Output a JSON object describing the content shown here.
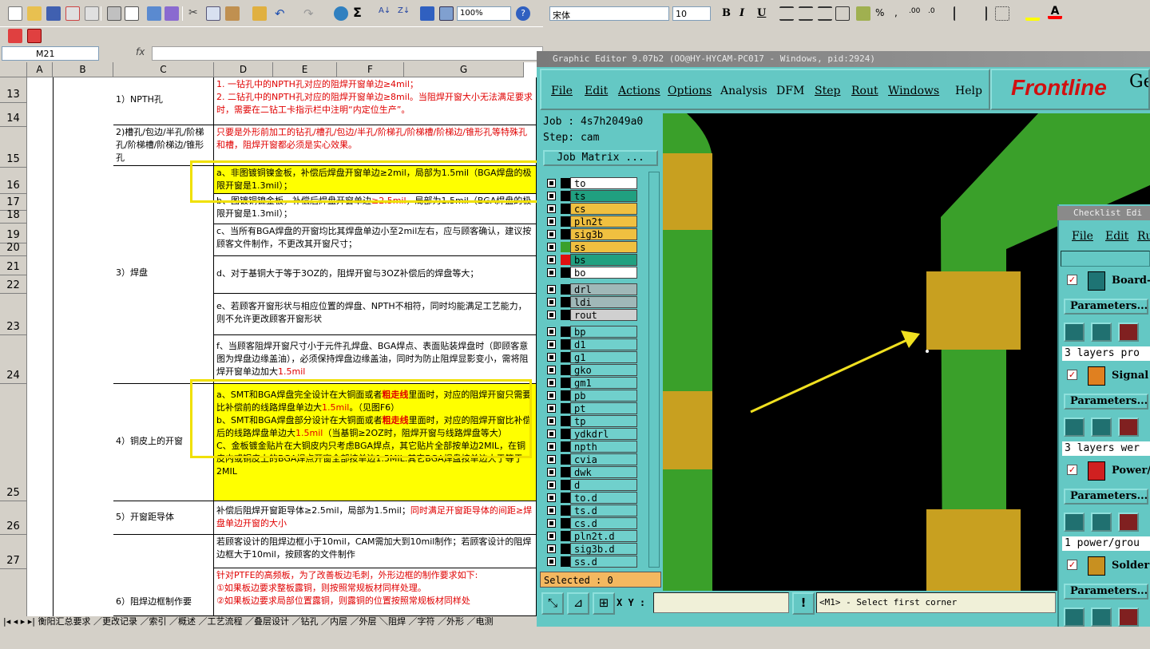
{
  "excel": {
    "zoom": "100%",
    "font": "宋体",
    "size": "10",
    "namebox": "M21",
    "fx": "fx",
    "col_headers": [
      "A",
      "B",
      "C",
      "D",
      "E",
      "F",
      "G"
    ],
    "row_headers": [
      "13",
      "14",
      "15",
      "16",
      "17",
      "18",
      "19",
      "20",
      "21",
      "22",
      "23",
      "24",
      "25",
      "26",
      "27"
    ],
    "rows": {
      "npth_label": "1）NPTH孔",
      "npth_text": "1. 一钻孔中的NPTH孔对应的阻焊开窗单边≥4mil；\n2. 二钻孔中的NPTH孔对应的阻焊开窗单边≥8mil。当阻焊开窗大小无法满足要求时，需要在二钻工卡指示栏中注明“内定位生产”。",
      "slot_label": "2)槽孔/包边/半孔/阶梯孔/阶梯槽/阶梯边/锥形孔",
      "slot_text": "只要是外形前加工的钻孔/槽孔/包边/半孔/阶梯孔/阶梯槽/阶梯边/锥形孔等特殊孔和槽，阻焊开窗都必须是实心效果。",
      "pad_label": "3）焊盘",
      "pad_a": "a、非图镀铜镍金板，补偿后焊盘开窗单边≥2mil，局部为1.5mil（BGA焊盘的极限开窗是1.3mil）；",
      "pad_b_1": "b、图镀铜镍金板，补偿后焊盘开窗单边",
      "pad_b_2": "≥2.5mil",
      "pad_b_3": "，局部为1.5mil（BGA焊盘的极限开窗是1.3mil）；",
      "pad_c": "c、当所有BGA焊盘的开窗均比其焊盘单边小至2mil左右，应与顾客确认，建议按顾客文件制作，不更改其开窗尺寸；",
      "pad_d": "d、对于基铜大于等于3OZ的，阻焊开窗与3OZ补偿后的焊盘等大；",
      "pad_e": "e、若顾客开窗形状与相应位置的焊盘、NPTH不相符，同时均能满足工艺能力，则不允许更改顾客开窗形状",
      "pad_f_1": "f、当顾客阻焊开窗尺寸小于元件孔焊盘、BGA焊点、表面贴装焊盘时（即顾客意图为焊盘边缘盖油），必须保持焊盘边缘盖油，同时为防止阻焊显影变小，需将阻焊开窗单边加大",
      "pad_f_2": "1.5mil",
      "copper_label": "4）铜皮上的开窗",
      "copper_a_1": "a、SMT和BGA焊盘完全设计在大铜面或者",
      "copper_a_2": "粗走线",
      "copper_a_3": "里面时，对应的阻焊开窗只需要比补偿前的线路焊盘单边大",
      "copper_a_4": "1.5mil",
      "copper_a_5": "。（见图F6）",
      "copper_b_1": "b、SMT和BGA焊盘部分设计在大铜面或者",
      "copper_b_2": "粗走线",
      "copper_b_3": "里面时，对应的阻焊开窗比补偿后的线路焊盘单边大",
      "copper_b_4": "1.5mil",
      "copper_b_5": "（当基铜≥2OZ时，阻焊开窗与线路焊盘等大）",
      "copper_c": "C、金板镀金贴片在大铜皮内只考虑BGA焊点，其它贴片全部按单边2MIL，在铜皮内或铜皮上的BGA焊点开窗全部按单边1.5MIL.其它BGA焊盘按单边大于等于2MIL",
      "window_label": "5）开窗距导体",
      "window_text_1": "补偿后阻焊开窗距导体≥2.5mil，局部为1.5mil；",
      "window_text_2": "同时满足开窗距导体的间距≥焊盘单边开窗的大小",
      "frame_label": "6）阻焊边框制作要",
      "frame_text_1": "若顾客设计的阻焊边框小于10mil，CAM需加大到10mil制作；若顾客设计的阻焊边框大于10mil，按顾客的文件制作",
      "frame_text_2": "针对PTFE的高频板，为了改善板边毛刺，外形边框的制作要求如下:\n①如果板边要求整板露铜，则按照常规板材同样处理。\n②如果板边要求局部位置露铜，则露铜的位置按照常规板材同样处"
    },
    "sheet_tabs": "衡阳汇总要求 ／更改记录 ／索引 ／概述 ／工艺流程 ／叠层设计 ／钻孔 ／内层 ／外层 ＼阻焊 ／字符 ／外形 ／电测"
  },
  "graphic_editor": {
    "title": "Graphic Editor 9.07b2 (OO@HY-HYCAM-PC017 - Windows, pid:2924)",
    "menu": [
      "File",
      "Edit",
      "Actions",
      "Options",
      "Analysis",
      "DFM",
      "Step",
      "Rout",
      "Windows",
      "Help"
    ],
    "logo": "Frontline",
    "logo_extra": "Ge",
    "job": "Job : 4s7h2049a0",
    "step": "Step: cam",
    "job_matrix": "Job Matrix ...",
    "layers": [
      {
        "name": "to",
        "color": "#ffffff"
      },
      {
        "name": "ts",
        "color": "#20a080"
      },
      {
        "name": "cs",
        "color": "#f0c040"
      },
      {
        "name": "pln2t",
        "color": "#f0c040"
      },
      {
        "name": "sig3b",
        "color": "#f0c040"
      },
      {
        "name": "ss",
        "color": "#f0c040"
      },
      {
        "name": "bs",
        "color": "#20a080"
      },
      {
        "name": "bo",
        "color": "#ffffff"
      },
      {
        "name": "drl",
        "color": "#a0b8b8"
      },
      {
        "name": "ldi",
        "color": "#a0b8b8"
      },
      {
        "name": "rout",
        "color": "#d0d0d0"
      },
      {
        "name": "bp",
        "color": "#70d0cc"
      },
      {
        "name": "d1",
        "color": "#70d0cc"
      },
      {
        "name": "g1",
        "color": "#70d0cc"
      },
      {
        "name": "gko",
        "color": "#70d0cc"
      },
      {
        "name": "gm1",
        "color": "#70d0cc"
      },
      {
        "name": "pb",
        "color": "#70d0cc"
      },
      {
        "name": "pt",
        "color": "#70d0cc"
      },
      {
        "name": "tp",
        "color": "#70d0cc"
      },
      {
        "name": "ydkdrl",
        "color": "#70d0cc"
      },
      {
        "name": "npth",
        "color": "#70d0cc"
      },
      {
        "name": "cvia",
        "color": "#70d0cc"
      },
      {
        "name": "dwk",
        "color": "#70d0cc"
      },
      {
        "name": "d",
        "color": "#70d0cc"
      },
      {
        "name": "to.d",
        "color": "#70d0cc"
      },
      {
        "name": "ts.d",
        "color": "#70d0cc"
      },
      {
        "name": "cs.d",
        "color": "#70d0cc"
      },
      {
        "name": "pln2t.d",
        "color": "#70d0cc"
      },
      {
        "name": "sig3b.d",
        "color": "#70d0cc"
      },
      {
        "name": "ss.d",
        "color": "#70d0cc"
      }
    ],
    "selected": "Selected : 0",
    "xy_label": "X Y :",
    "prompt": "<M1> - Select first corner",
    "excl": "!"
  },
  "checklist": {
    "title": "Checklist Edi",
    "menu": [
      "File",
      "Edit",
      "Ru"
    ],
    "items": [
      {
        "title": "Board-l",
        "params": "Parameters...",
        "status": "3 layers pro"
      },
      {
        "title": "Signal I",
        "params": "Parameters...",
        "status": "3 layers wer"
      },
      {
        "title": "Power/G",
        "params": "Parameters...",
        "status": "1 power/grou"
      },
      {
        "title": "Solder M",
        "params": "Parameters...",
        "status": ""
      }
    ]
  },
  "colors": {
    "board_green": "#3aa02a",
    "pad_gold": "#c8a020",
    "arrow": "#f0e020",
    "cyan": "#64c8c4"
  }
}
